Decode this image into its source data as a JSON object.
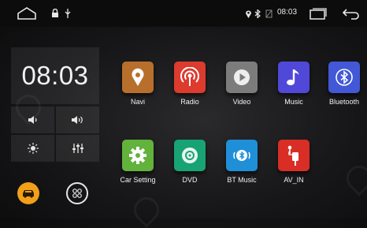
{
  "status_bar": {
    "time": "08:03",
    "left_icons": [
      "home-icon",
      "lock-icon",
      "usb-icon"
    ],
    "right_icons": [
      "location-icon",
      "bluetooth-icon",
      "signal-icon",
      "recent-apps-icon",
      "back-icon"
    ]
  },
  "side_panel": {
    "clock": "08:03",
    "controls": [
      {
        "name": "volume-down-button",
        "icon": "volume-down-icon"
      },
      {
        "name": "volume-up-button",
        "icon": "volume-up-icon"
      },
      {
        "name": "brightness-button",
        "icon": "brightness-icon"
      },
      {
        "name": "equalizer-button",
        "icon": "equalizer-icon"
      }
    ],
    "bottom_buttons": [
      {
        "name": "car-mode-button",
        "icon": "car-icon",
        "color": "#f0a019"
      },
      {
        "name": "app-drawer-button",
        "icon": "app-drawer-icon",
        "color": "#e6e6e6"
      }
    ]
  },
  "apps": [
    {
      "label": "Navi",
      "color": "#b86f2c"
    },
    {
      "label": "Radio",
      "color": "#dc3b2e"
    },
    {
      "label": "Video",
      "color": "#7c7c7c"
    },
    {
      "label": "Music",
      "color": "#5048d8"
    },
    {
      "label": "Bluetooth",
      "color": "#4258d6"
    },
    {
      "label": "Car Setting",
      "color": "#62b23c"
    },
    {
      "label": "DVD",
      "color": "#18a374"
    },
    {
      "label": "BT Music",
      "color": "#1f8fd8"
    },
    {
      "label": "AV_IN",
      "color": "#d82e26"
    }
  ]
}
